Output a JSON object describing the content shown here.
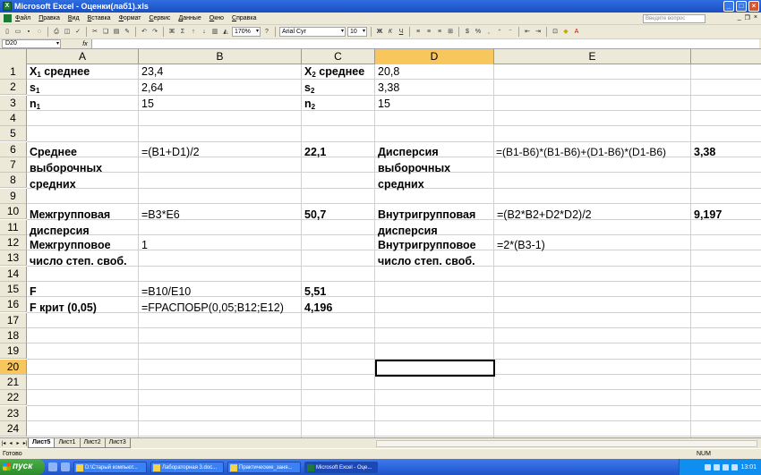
{
  "window": {
    "title": "Microsoft Excel - Оценки(лаб1).xls"
  },
  "menu": {
    "items": [
      "Файл",
      "Правка",
      "Вид",
      "Вставка",
      "Формат",
      "Сервис",
      "Данные",
      "Окно",
      "Справка"
    ],
    "help_placeholder": "Введите вопрос"
  },
  "toolbar": {
    "zoom": "170%",
    "font": "Arial Cyr",
    "font_size": "10",
    "bold": "Ж",
    "italic": "К",
    "underline": "Ч"
  },
  "formula_bar": {
    "name_box": "D20",
    "fx_label": "fx",
    "content": ""
  },
  "grid": {
    "columns": [
      "A",
      "B",
      "C",
      "D",
      "E"
    ],
    "rows": [
      "1",
      "2",
      "3",
      "4",
      "5",
      "6",
      "7",
      "8",
      "9",
      "10",
      "11",
      "12",
      "13",
      "14",
      "15",
      "16",
      "17",
      "18",
      "19",
      "20",
      "21",
      "22",
      "23",
      "24"
    ],
    "selected_column": "D",
    "selected_row": "20",
    "cells": {
      "A1": "X",
      "A1_sub": "1",
      "A1_rest": " среднее",
      "B1": "23,4",
      "C1": "X",
      "C1_sub": "2",
      "C1_rest": " среднее",
      "D1": "20,8",
      "A2": "s",
      "A2_sub": "1",
      "B2": "2,64",
      "C2": "s",
      "C2_sub": "2",
      "D2": "3,38",
      "A3": "n",
      "A3_sub": "1",
      "B3": "15",
      "C3": "n",
      "C3_sub": "2",
      "D3": "15",
      "A6": "Среднее",
      "A7": "выборочных",
      "A8": "средних",
      "B6": "=(B1+D1)/2",
      "C6": "22,1",
      "D6": "Дисперсия",
      "D7": "выборочных",
      "D8": "средних",
      "E6": "=(B1-B6)*(B1-B6)+(D1-B6)*(D1-B6)",
      "F6": "3,38",
      "A10": "Межгрупповая",
      "A11": "дисперсия",
      "B10": "=B3*E6",
      "C10": "50,7",
      "D10": "Внутригрупповая",
      "D11": "дисперсия",
      "E10": "=(B2*B2+D2*D2)/2",
      "F10": "9,197",
      "A12": "Межгрупповое",
      "A13": "число степ. своб.",
      "B12": "1",
      "D12": "Внутригрупповое",
      "D13": "число степ. своб.",
      "E12": "=2*(B3-1)",
      "A15": "F",
      "B15": "=B10/E10",
      "C15": "5,51",
      "A16": "F крит (0,05)",
      "B16": "=FРАСПОБР(0,05;B12;E12)",
      "C16": "4,196"
    }
  },
  "sheet_tabs": [
    "Лист5",
    "Лист1",
    "Лист2",
    "Лист3"
  ],
  "active_sheet": "Лист5",
  "status": {
    "left": "Готово",
    "num": "NUM"
  },
  "taskbar": {
    "start": "пуск",
    "tasks": [
      "D:\\Старый компьют...",
      "Лабораторная 3.doc...",
      "Практические_заня...",
      "Microsoft Excel - Оце..."
    ],
    "active_task": 3,
    "clock": "13:01"
  }
}
